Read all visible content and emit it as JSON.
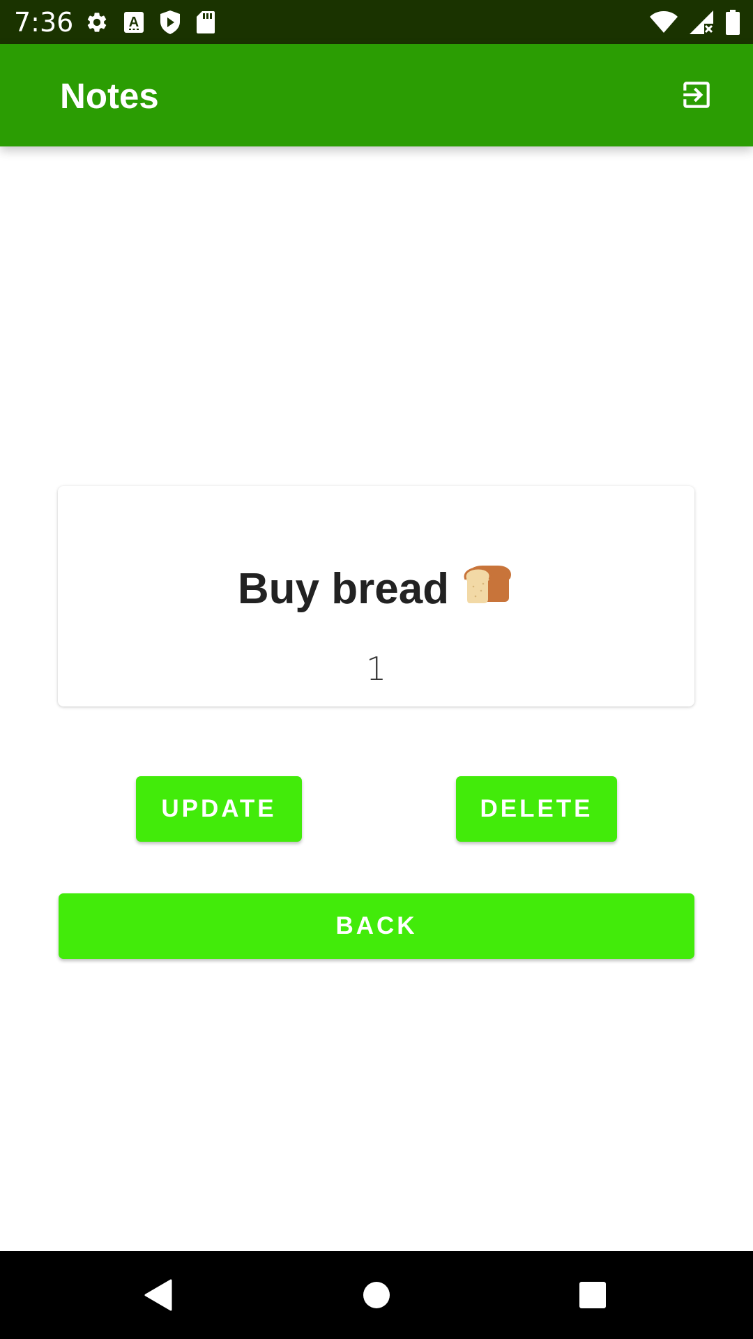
{
  "status_bar": {
    "time": "7:36",
    "left_icons": [
      "gear-icon",
      "keyboard-a-icon",
      "shield-play-icon",
      "sd-card-icon"
    ],
    "right_icons": [
      "wifi-icon",
      "signal-no-data-icon",
      "battery-icon"
    ]
  },
  "app_bar": {
    "title": "Notes",
    "action_icon": "exit-to-app-icon",
    "color": "#2b9d03"
  },
  "note": {
    "title": "Buy bread",
    "title_icon": "bread-icon",
    "body": "1"
  },
  "buttons": {
    "update_label": "UPDATE",
    "delete_label": "DELETE",
    "back_label": "BACK",
    "color": "#42eb0a"
  },
  "nav_bar": {
    "icons": [
      "back-triangle-icon",
      "home-circle-icon",
      "recents-square-icon"
    ]
  }
}
